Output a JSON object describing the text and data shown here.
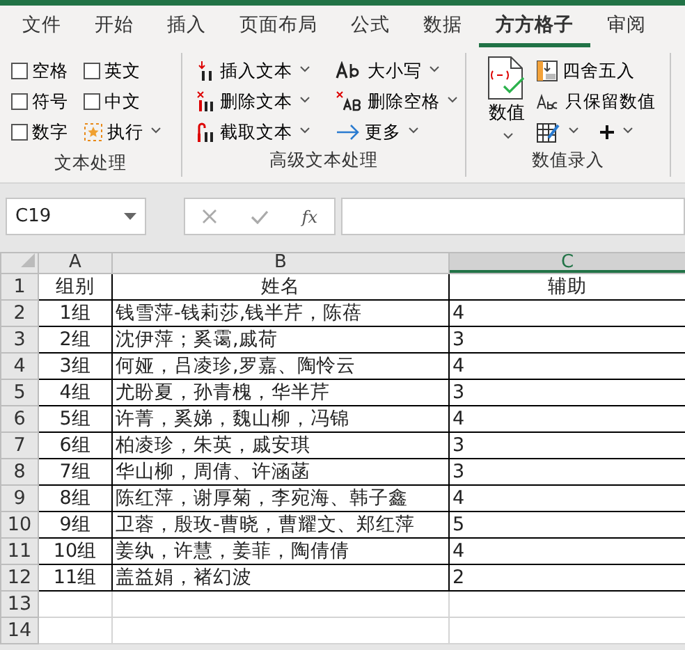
{
  "ribbon_tabs": [
    {
      "label": "文件",
      "selected": false
    },
    {
      "label": "开始",
      "selected": false
    },
    {
      "label": "插入",
      "selected": false
    },
    {
      "label": "页面布局",
      "selected": false
    },
    {
      "label": "公式",
      "selected": false
    },
    {
      "label": "数据",
      "selected": false
    },
    {
      "label": "方方格子",
      "selected": true
    },
    {
      "label": "审阅",
      "selected": false
    }
  ],
  "groups": [
    {
      "label": "文本处理",
      "options": [
        {
          "label": "空格",
          "checked": false
        },
        {
          "label": "英文",
          "checked": false
        },
        {
          "label": "符号",
          "checked": false
        },
        {
          "label": "中文",
          "checked": false
        },
        {
          "label": "数字",
          "checked": false
        }
      ],
      "run_button": "执行"
    },
    {
      "label": "高级文本处理",
      "buttons": [
        {
          "label": "插入文本"
        },
        {
          "label": "大小写"
        },
        {
          "label": "删除文本"
        },
        {
          "label": "删除空格"
        },
        {
          "label": "截取文本"
        },
        {
          "label": "更多"
        }
      ]
    },
    {
      "label": "数值录入",
      "large_button": "数值",
      "buttons": [
        {
          "label": "四舍五入"
        },
        {
          "label": "只保留数值"
        }
      ]
    }
  ],
  "formula_bar": {
    "name_box": "C19",
    "function_label": "fx"
  },
  "sheet": {
    "columns": [
      {
        "label": "A",
        "selected": false
      },
      {
        "label": "B",
        "selected": false
      },
      {
        "label": "C",
        "selected": true
      }
    ],
    "rows": [
      {
        "number": "1",
        "cells": [
          "组别",
          "姓名",
          "辅助"
        ]
      },
      {
        "number": "2",
        "cells": [
          "1组",
          "钱雪萍-钱莉莎,钱半芹，陈蓓",
          "4"
        ]
      },
      {
        "number": "3",
        "cells": [
          "2组",
          "沈伊萍；奚霭,戚荷",
          "3"
        ]
      },
      {
        "number": "4",
        "cells": [
          "3组",
          "何娅，吕凌珍,罗嘉、陶怜云",
          "4"
        ]
      },
      {
        "number": "5",
        "cells": [
          "4组",
          "尤盼夏，孙青槐，华半芹",
          "3"
        ]
      },
      {
        "number": "6",
        "cells": [
          "5组",
          "许菁，奚娣，魏山柳，冯锦",
          "4"
        ]
      },
      {
        "number": "7",
        "cells": [
          "6组",
          "柏凌珍，朱英，戚安琪",
          "3"
        ]
      },
      {
        "number": "8",
        "cells": [
          "7组",
          "华山柳，周倩、许涵菡",
          "3"
        ]
      },
      {
        "number": "9",
        "cells": [
          "8组",
          "陈红萍，谢厚菊，李宛海、韩子鑫",
          "4"
        ]
      },
      {
        "number": "10",
        "cells": [
          "9组",
          "卫蓉，殷玫-曹晓，曹耀文、郑红萍",
          "5"
        ]
      },
      {
        "number": "11",
        "cells": [
          "10组",
          "姜纨，许慧，姜菲，陶倩倩",
          "4"
        ]
      },
      {
        "number": "12",
        "cells": [
          "11组",
          "盖益娟，褚幻波",
          "2"
        ]
      },
      {
        "number": "13",
        "cells": []
      },
      {
        "number": "14",
        "cells": []
      }
    ]
  }
}
